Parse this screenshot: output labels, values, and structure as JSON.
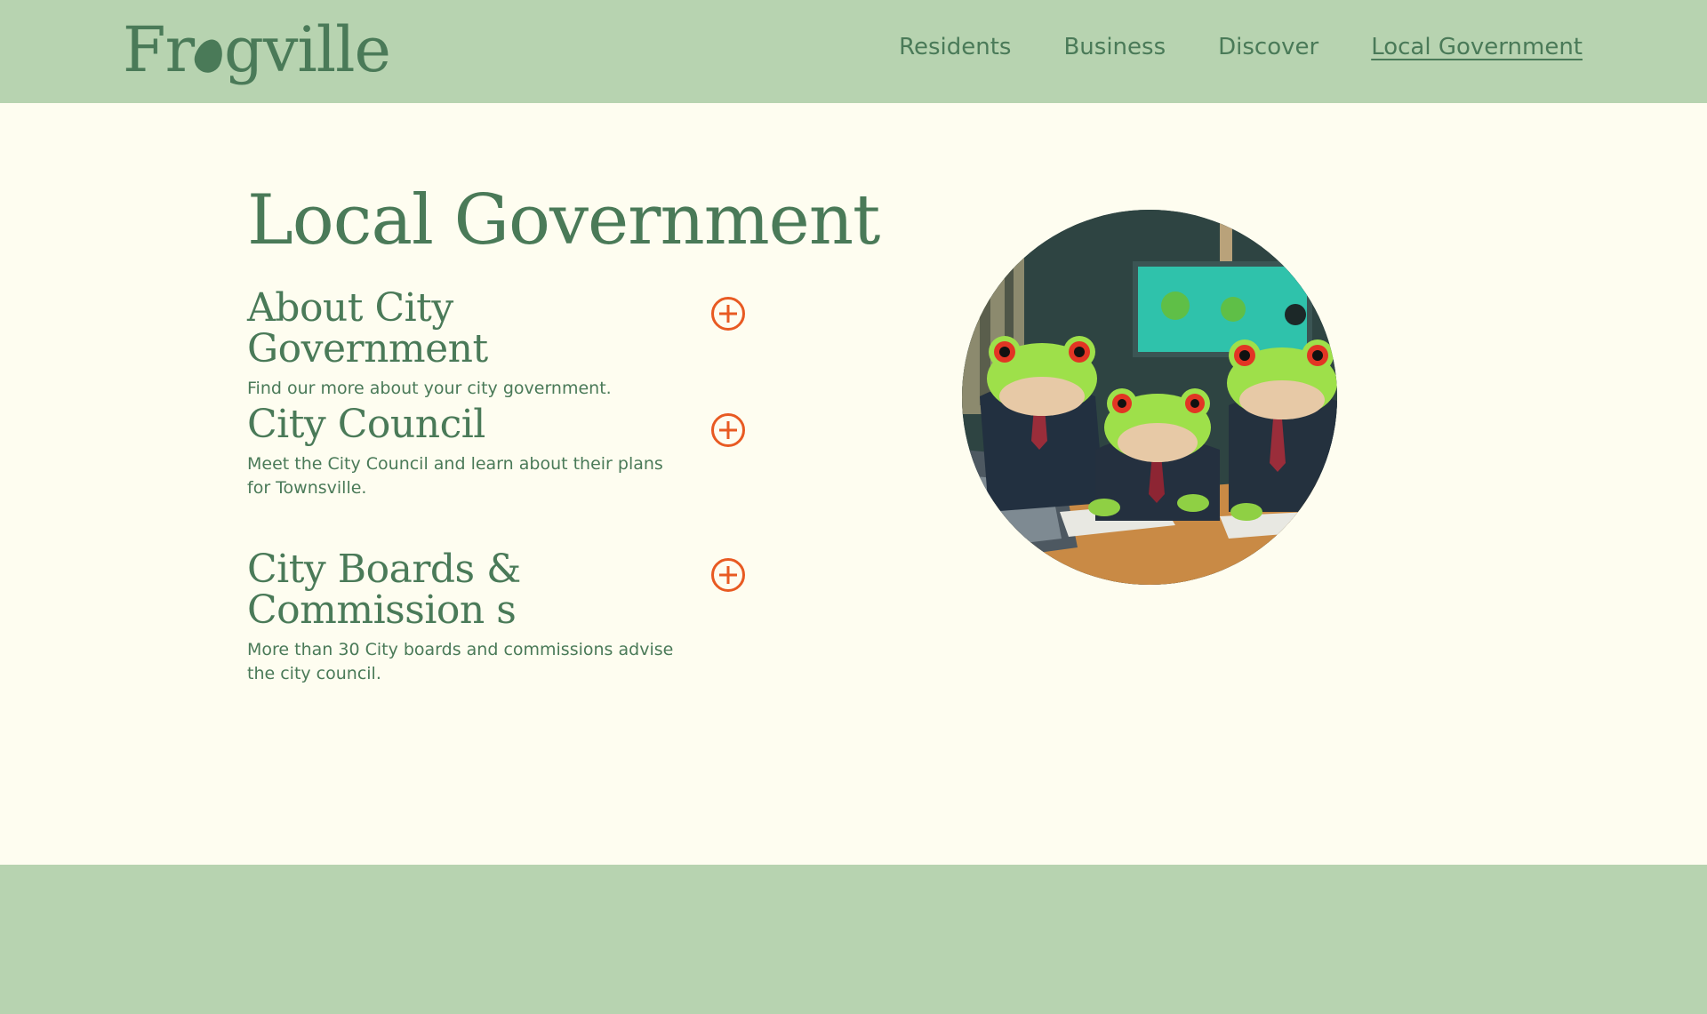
{
  "brand": {
    "logo_prefix": "Fr",
    "logo_suffix": "gville"
  },
  "nav": {
    "items": [
      {
        "label": "Residents",
        "active": false
      },
      {
        "label": "Business",
        "active": false
      },
      {
        "label": "Discover",
        "active": false
      },
      {
        "label": "Local Government",
        "active": true
      }
    ]
  },
  "main": {
    "title": "Local Government",
    "sections": [
      {
        "heading": "About City Government",
        "description": "Find our more about your city government."
      },
      {
        "heading": "City Council",
        "description": "Meet the City Council and learn about their plans for Townsville."
      },
      {
        "heading": "City Boards & Commission s",
        "description": "More than 30 City boards and commissions advise the city council."
      }
    ]
  },
  "colors": {
    "header_bg": "#b7d3b0",
    "page_bg": "#fefdf0",
    "text": "#4a7a58",
    "accent": "#e85a22"
  },
  "icons": {
    "expand": "plus-circle-icon"
  }
}
